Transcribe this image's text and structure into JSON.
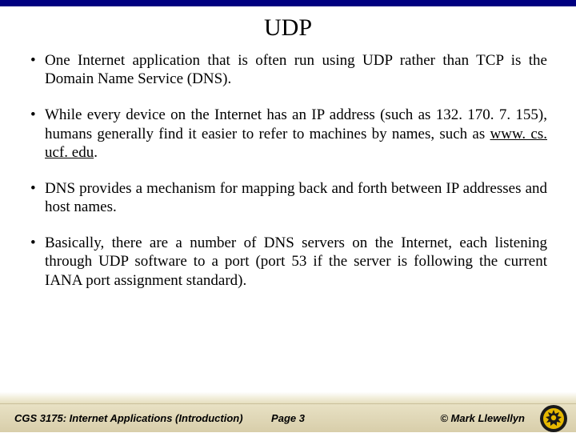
{
  "title": "UDP",
  "bullets": [
    {
      "text": "One Internet application that is often run using UDP rather than TCP is the Domain Name Service (DNS)."
    },
    {
      "text_before": "While every device on the Internet has an IP address (such as 132. 170. 7. 155), humans generally find it easier to refer to machines by names, such as ",
      "link": "www. cs. ucf. edu",
      "text_after": "."
    },
    {
      "text": "DNS provides a mechanism for mapping back and forth between IP addresses and host names."
    },
    {
      "text": "Basically, there are a number of DNS servers on the Internet, each listening through UDP software to a port (port 53 if the server is following the current IANA port assignment standard)."
    }
  ],
  "footer": {
    "left": "CGS 3175: Internet Applications (Introduction)",
    "center": "Page 3",
    "right": "© Mark Llewellyn"
  }
}
